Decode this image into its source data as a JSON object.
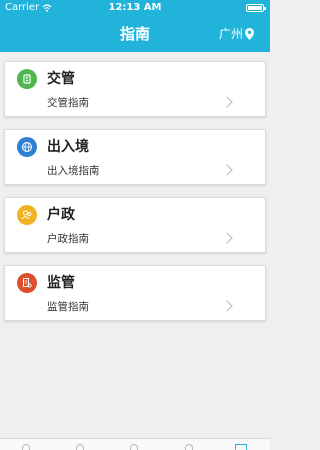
{
  "status_bar": {
    "carrier": "Carrier",
    "time": "12:13 AM"
  },
  "header": {
    "title": "指南",
    "city": "广州"
  },
  "cards": [
    {
      "title": "交管",
      "subtitle": "交管指南",
      "icon": "traffic-icon",
      "color": "#4fb652"
    },
    {
      "title": "出入境",
      "subtitle": "出入境指南",
      "icon": "globe-icon",
      "color": "#2f7fd3"
    },
    {
      "title": "户政",
      "subtitle": "户政指南",
      "icon": "household-icon",
      "color": "#efb323"
    },
    {
      "title": "监管",
      "subtitle": "监管指南",
      "icon": "supervision-icon",
      "color": "#dc4e2c"
    }
  ],
  "colors": {
    "accent": "#21b3da",
    "background": "#efefef"
  }
}
